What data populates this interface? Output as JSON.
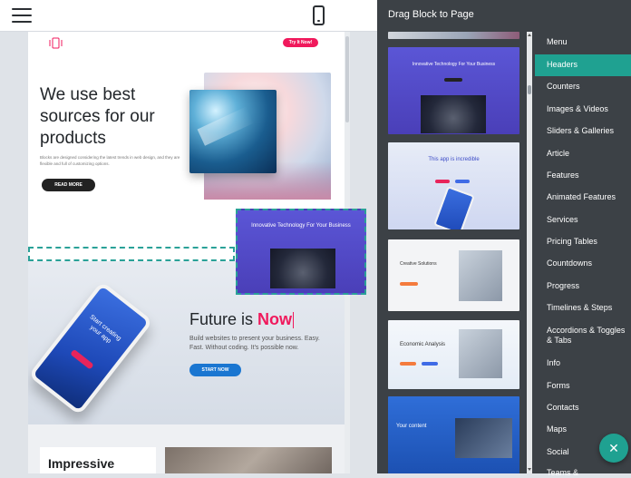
{
  "panel": {
    "title": "Drag Block to Page"
  },
  "page": {
    "try_it_label": "Try It Now!",
    "headline": "We use best sources for our products",
    "headline_sub": "Blocks are designed considering the latest trends in web design, and they are flexible and full of customizing options.",
    "read_more_label": "READ MORE",
    "future_prefix": "Future is ",
    "future_highlight": "Now",
    "future_sub": "Build websites to present your business. Easy. Fast. Without coding. It's possible now.",
    "start_now_label": "START NOW",
    "phone_text": "Start creating your app",
    "impressive": "Impressive"
  },
  "drag_card": {
    "title": "Innovative Technology For Your Business"
  },
  "thumbnails": [
    {
      "title": "Innovative Technology For Your Business"
    },
    {
      "title": "This app is incredible"
    },
    {
      "title": "Creative Solutions"
    },
    {
      "title": "Economic Analysis"
    },
    {
      "title": "Your content"
    }
  ],
  "categories": [
    {
      "label": "Menu"
    },
    {
      "label": "Headers",
      "active": true
    },
    {
      "label": "Counters"
    },
    {
      "label": "Images & Videos"
    },
    {
      "label": "Sliders & Galleries"
    },
    {
      "label": "Article"
    },
    {
      "label": "Features"
    },
    {
      "label": "Animated Features"
    },
    {
      "label": "Services"
    },
    {
      "label": "Pricing Tables"
    },
    {
      "label": "Countdowns"
    },
    {
      "label": "Progress"
    },
    {
      "label": "Timelines & Steps"
    },
    {
      "label": "Accordions & Toggles & Tabs"
    },
    {
      "label": "Info"
    },
    {
      "label": "Forms"
    },
    {
      "label": "Contacts"
    },
    {
      "label": "Maps"
    },
    {
      "label": "Social"
    },
    {
      "label": "Teams &"
    }
  ],
  "icons": {
    "menu": "hamburger-icon",
    "device": "mobile-phone-icon",
    "close": "close-icon",
    "logo": "phone-vibrate-icon"
  },
  "colors": {
    "accent": "#1fa191",
    "brand_pink": "#f0195c",
    "panel_bg": "#3c4146",
    "start_now": "#1a76d1"
  }
}
